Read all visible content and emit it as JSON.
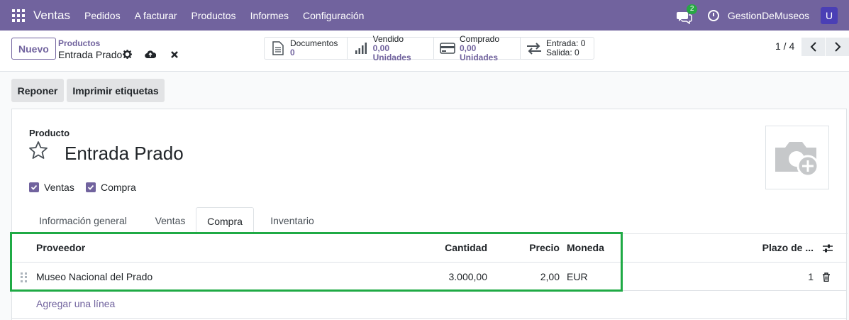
{
  "navbar": {
    "app_name": "Ventas",
    "menu": [
      "Pedidos",
      "A facturar",
      "Productos",
      "Informes",
      "Configuración"
    ],
    "chat_count": "2",
    "company": "GestionDeMuseos",
    "avatar_letter": "U",
    "bg_color": "#71639e"
  },
  "control": {
    "new_button": "Nuevo",
    "breadcrumb_parent": "Productos",
    "breadcrumb_current": "Entrada Prado",
    "stats": [
      {
        "icon": "document-icon",
        "label": "Documentos",
        "value": "0"
      },
      {
        "icon": "bar-chart-icon",
        "label": "Vendido",
        "value": "0,00 Unidades"
      },
      {
        "icon": "credit-card-icon",
        "label": "Comprado",
        "value": "0,00 Unidades"
      },
      {
        "icon": "transfer-icon",
        "label": "Entrada: 0",
        "value": "Salida: 0"
      }
    ],
    "pager": "1 / 4"
  },
  "actions": {
    "replenish": "Reponer",
    "print_labels": "Imprimir etiquetas"
  },
  "form": {
    "product_label": "Producto",
    "product_name": "Entrada Prado",
    "checkboxes": [
      {
        "label": "Ventas",
        "checked": true
      },
      {
        "label": "Compra",
        "checked": true
      }
    ],
    "tabs": [
      "Información general",
      "Ventas",
      "Compra",
      "Inventario"
    ],
    "active_tab": "Compra"
  },
  "vendor_table": {
    "headers": {
      "vendor": "Proveedor",
      "quantity": "Cantidad",
      "price": "Precio",
      "currency": "Moneda",
      "lead_time": "Plazo de ..."
    },
    "rows": [
      {
        "vendor": "Museo Nacional del Prado",
        "quantity": "3.000,00",
        "price": "2,00",
        "currency": "EUR",
        "lead_time": "1"
      }
    ],
    "add_line": "Agregar una línea"
  },
  "accent_color": "#71639e",
  "highlight_color": "#1faa45"
}
